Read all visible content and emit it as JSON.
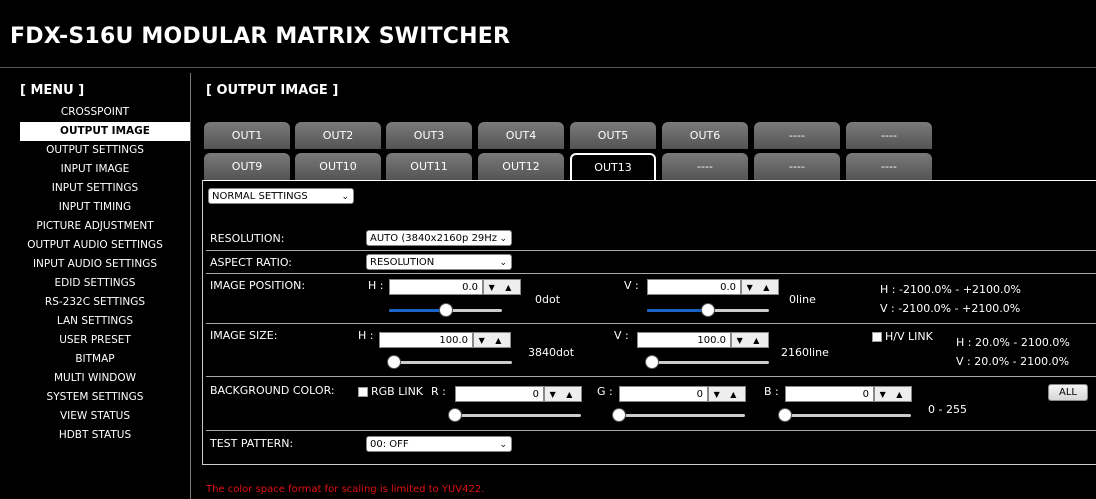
{
  "app": {
    "title": "FDX-S16U MODULAR MATRIX SWITCHER"
  },
  "menu": {
    "heading": "[ MENU ]",
    "items": [
      {
        "label": "CROSSPOINT"
      },
      {
        "label": "OUTPUT IMAGE",
        "active": true
      },
      {
        "label": "OUTPUT SETTINGS"
      },
      {
        "label": "INPUT IMAGE"
      },
      {
        "label": "INPUT SETTINGS"
      },
      {
        "label": "INPUT TIMING"
      },
      {
        "label": "PICTURE ADJUSTMENT"
      },
      {
        "label": "OUTPUT AUDIO SETTINGS"
      },
      {
        "label": "INPUT AUDIO SETTINGS"
      },
      {
        "label": "EDID SETTINGS"
      },
      {
        "label": "RS-232C SETTINGS"
      },
      {
        "label": "LAN SETTINGS"
      },
      {
        "label": "USER PRESET"
      },
      {
        "label": "BITMAP"
      },
      {
        "label": "MULTI WINDOW"
      },
      {
        "label": "SYSTEM SETTINGS"
      },
      {
        "label": "VIEW STATUS"
      },
      {
        "label": "HDBT STATUS"
      }
    ]
  },
  "page": {
    "heading": "[ OUTPUT IMAGE ]",
    "tabs_row1": [
      "OUT1",
      "OUT2",
      "OUT3",
      "OUT4",
      "OUT5",
      "OUT6",
      "----",
      "----"
    ],
    "tabs_row2": [
      "OUT9",
      "OUT10",
      "OUT11",
      "OUT12",
      "OUT13",
      "----",
      "----",
      "----"
    ],
    "active_tab": "OUT13",
    "mode_select": "NORMAL SETTINGS"
  },
  "settings": {
    "resolution": {
      "label": "RESOLUTION:",
      "value": "AUTO (3840x2160p 29Hz"
    },
    "aspect_ratio": {
      "label": "ASPECT RATIO:",
      "value": "RESOLUTION"
    },
    "image_position": {
      "label": "IMAGE POSITION:",
      "h_label": "H :",
      "h_value": "0.0",
      "h_readout": "0dot",
      "h_level": 0.5,
      "v_label": "V :",
      "v_value": "0.0",
      "v_readout": "0line",
      "v_level": 0.5,
      "h_range": "H : -2100.0% - +2100.0%",
      "v_range": "V : -2100.0% - +2100.0%"
    },
    "image_size": {
      "label": "IMAGE SIZE:",
      "h_label": "H :",
      "h_value": "100.0",
      "h_readout": "3840dot",
      "h_level": 0.04,
      "v_label": "V :",
      "v_value": "100.0",
      "v_readout": "2160line",
      "v_level": 0.04,
      "link_label": "H/V LINK",
      "h_range": "H : 20.0% - 2100.0%",
      "v_range": "V : 20.0% - 2100.0%"
    },
    "background_color": {
      "label": "BACKGROUND COLOR:",
      "rgb_link_label": "RGB LINK",
      "r_label": "R :",
      "r_value": "0",
      "r_level": 0,
      "g_label": "G :",
      "g_value": "0",
      "g_level": 0,
      "b_label": "B :",
      "b_value": "0",
      "b_level": 0,
      "range": "0 - 255",
      "all_button": "ALL"
    },
    "test_pattern": {
      "label": "TEST PATTERN:",
      "value": "00: OFF"
    }
  },
  "note": "The color space format for scaling is limited to YUV422.",
  "icons": {
    "chevron": "chevron-down-icon",
    "spin_arrows": "▼ ▲"
  },
  "colors": {
    "accent": "#1a63c7",
    "note": "#e01010",
    "tab": "#6a6a6a"
  }
}
